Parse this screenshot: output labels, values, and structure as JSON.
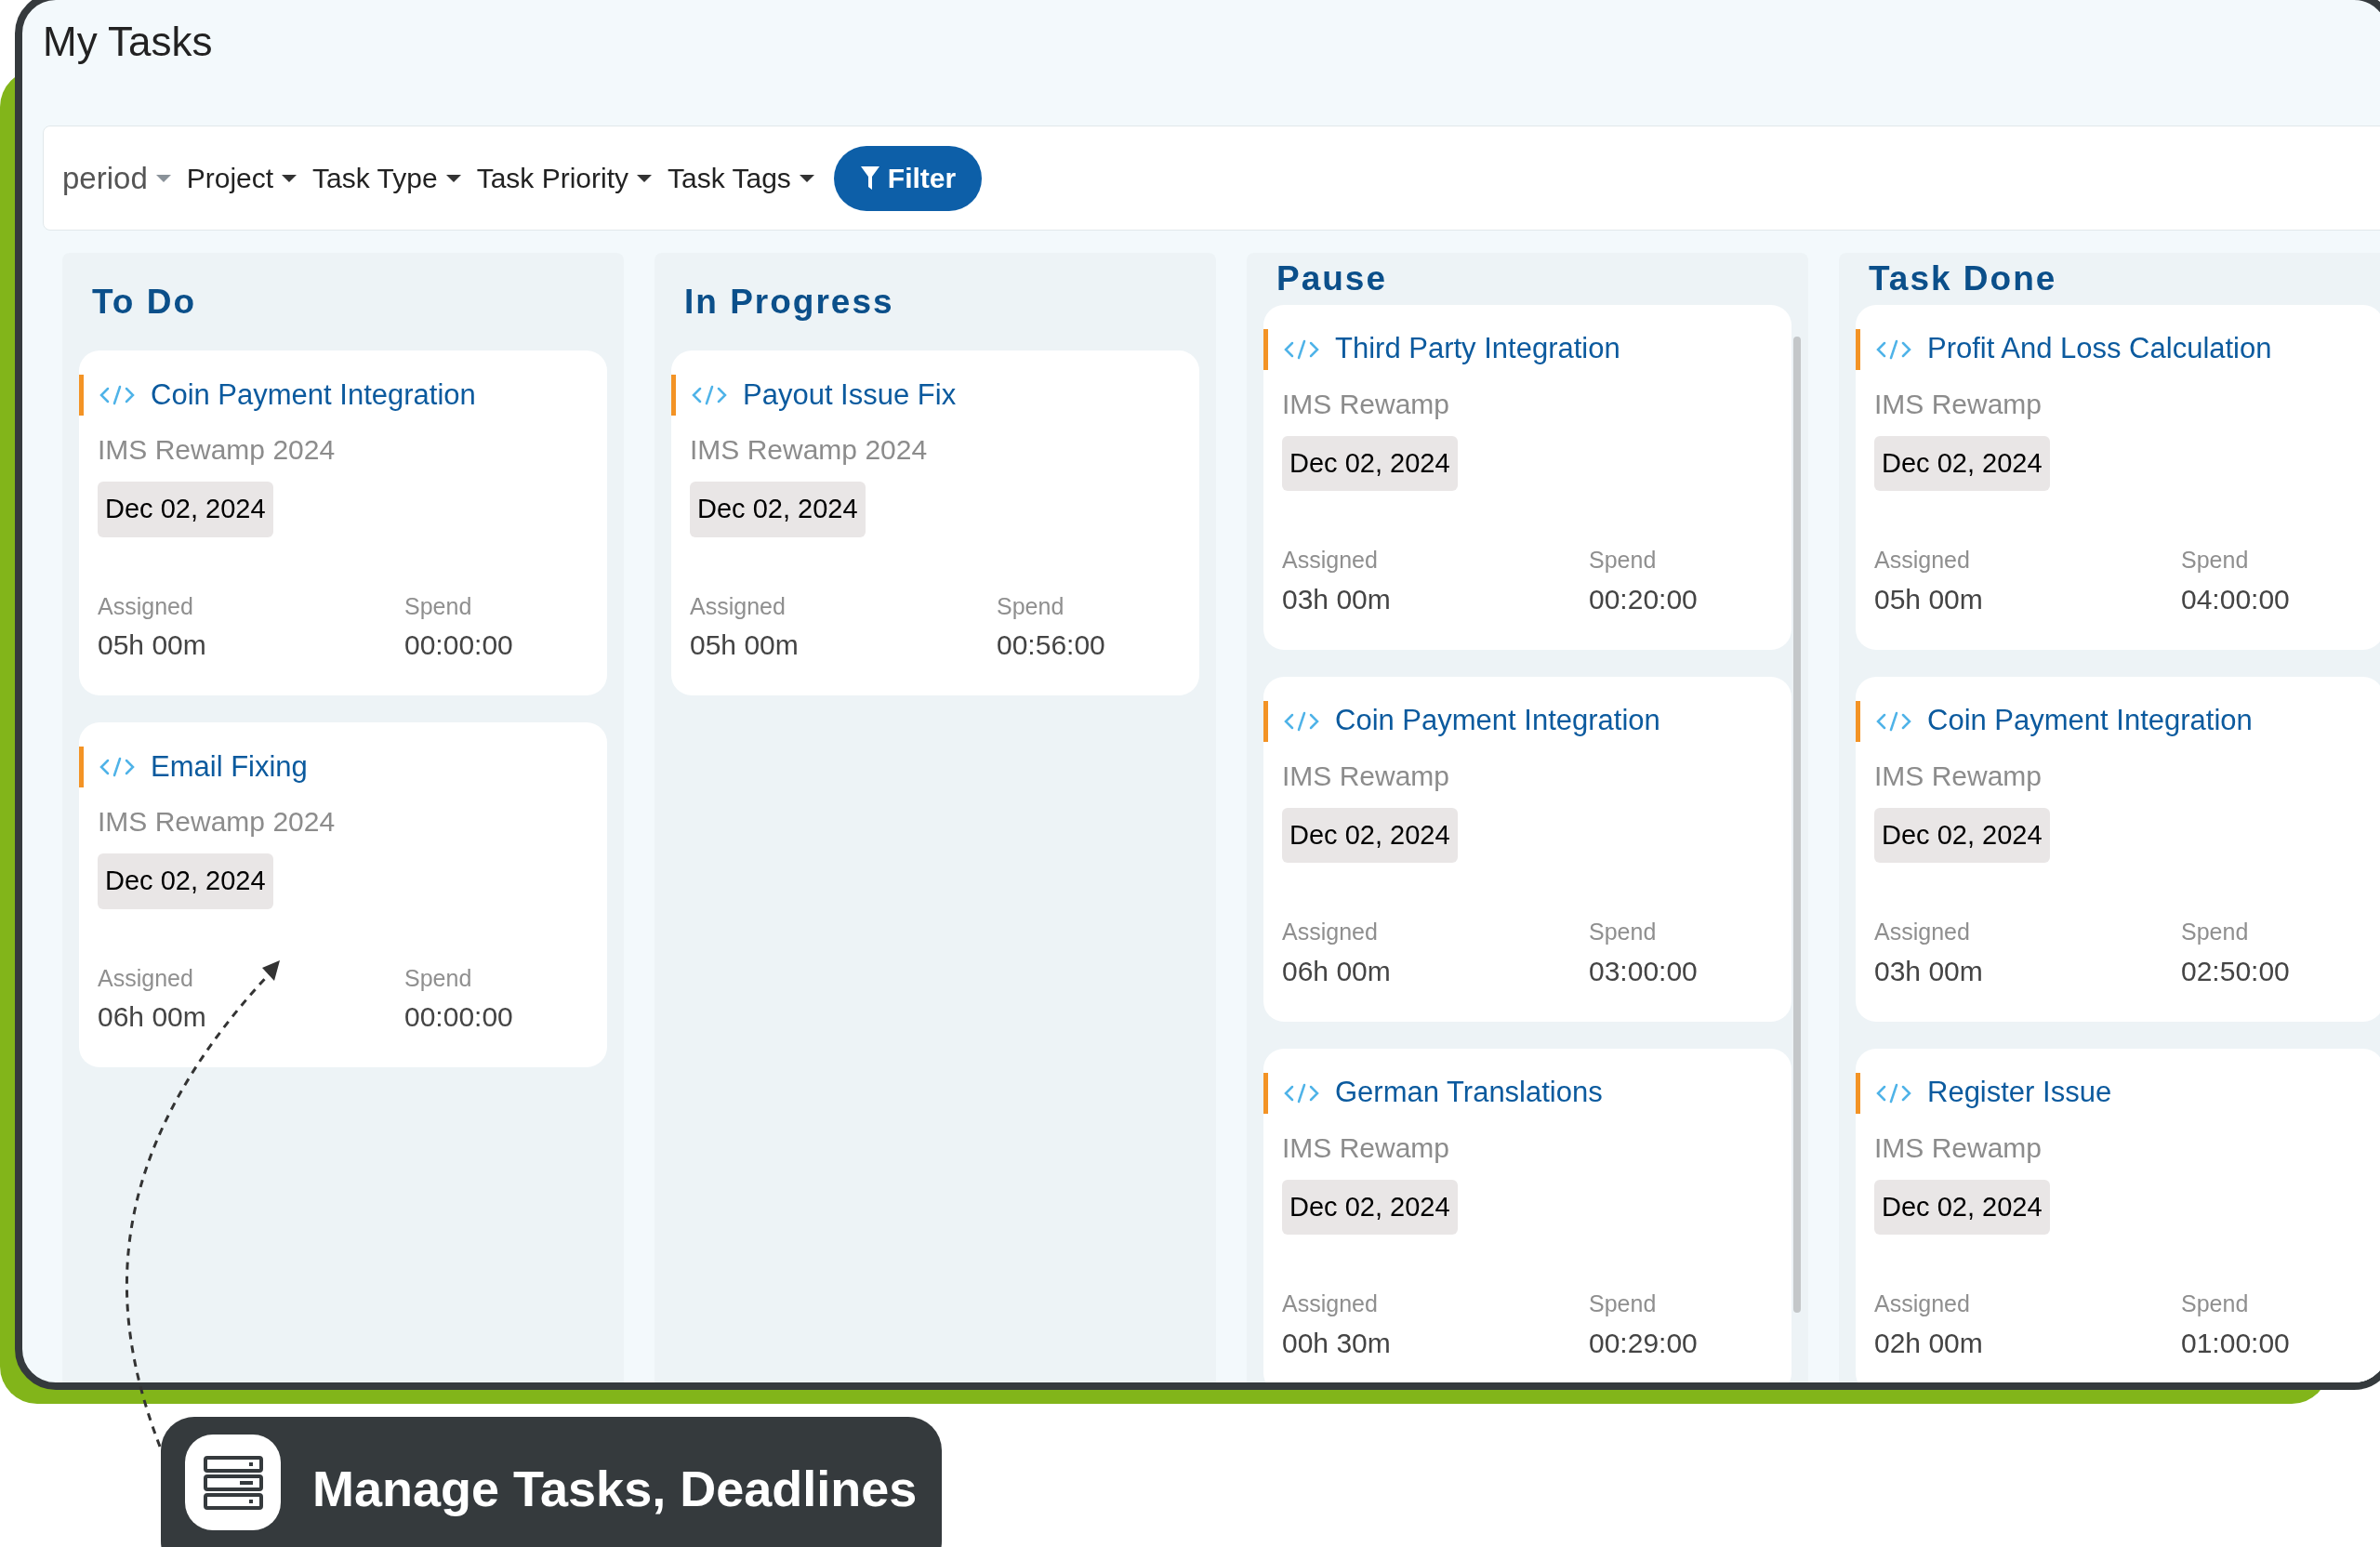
{
  "page": {
    "title": "My Tasks"
  },
  "filters": [
    {
      "label": "period",
      "kind": "placeholder"
    },
    {
      "label": "Project",
      "kind": "dropdown"
    },
    {
      "label": "Task Type",
      "kind": "dropdown"
    },
    {
      "label": "Task Priority",
      "kind": "dropdown"
    },
    {
      "label": "Task Tags",
      "kind": "dropdown"
    }
  ],
  "filter_button": {
    "label": "Filter"
  },
  "columns": [
    {
      "title": "To Do",
      "tasks": [
        {
          "title": "Coin Payment Integration",
          "project": "IMS Rewamp 2024",
          "date": "Dec 02, 2024",
          "assigned_label": "Assigned",
          "assigned": "05h 00m",
          "spend_label": "Spend",
          "spend": "00:00:00"
        },
        {
          "title": "Email Fixing",
          "project": "IMS Rewamp 2024",
          "date": "Dec 02, 2024",
          "assigned_label": "Assigned",
          "assigned": "06h 00m",
          "spend_label": "Spend",
          "spend": "00:00:00"
        }
      ]
    },
    {
      "title": "In Progress",
      "tasks": [
        {
          "title": "Payout Issue Fix",
          "project": "IMS Rewamp 2024",
          "date": "Dec 02, 2024",
          "assigned_label": "Assigned",
          "assigned": "05h 00m",
          "spend_label": "Spend",
          "spend": "00:56:00"
        }
      ]
    },
    {
      "title": "Pause",
      "tasks": [
        {
          "title": "Third Party Integration",
          "project": "IMS Rewamp",
          "date": "Dec 02, 2024",
          "assigned_label": "Assigned",
          "assigned": "03h 00m",
          "spend_label": "Spend",
          "spend": "00:20:00"
        },
        {
          "title": "Coin Payment Integration",
          "project": "IMS Rewamp",
          "date": "Dec 02, 2024",
          "assigned_label": "Assigned",
          "assigned": "06h 00m",
          "spend_label": "Spend",
          "spend": "03:00:00"
        },
        {
          "title": "German Translations",
          "project": "IMS Rewamp",
          "date": "Dec 02, 2024",
          "assigned_label": "Assigned",
          "assigned": "00h 30m",
          "spend_label": "Spend",
          "spend": "00:29:00"
        }
      ]
    },
    {
      "title": "Task Done",
      "tasks": [
        {
          "title": "Profit And Loss Calculation",
          "project": "IMS Rewamp",
          "date": "Dec 02, 2024",
          "assigned_label": "Assigned",
          "assigned": "05h 00m",
          "spend_label": "Spend",
          "spend": "04:00:00"
        },
        {
          "title": "Coin Payment Integration",
          "project": "IMS Rewamp",
          "date": "Dec 02, 2024",
          "assigned_label": "Assigned",
          "assigned": "03h 00m",
          "spend_label": "Spend",
          "spend": "02:50:00"
        },
        {
          "title": "Register Issue",
          "project": "IMS Rewamp",
          "date": "Dec 02, 2024",
          "assigned_label": "Assigned",
          "assigned": "02h 00m",
          "spend_label": "Spend",
          "spend": "01:00:00"
        }
      ]
    }
  ],
  "callout": {
    "text": "Manage Tasks, Deadlines"
  }
}
